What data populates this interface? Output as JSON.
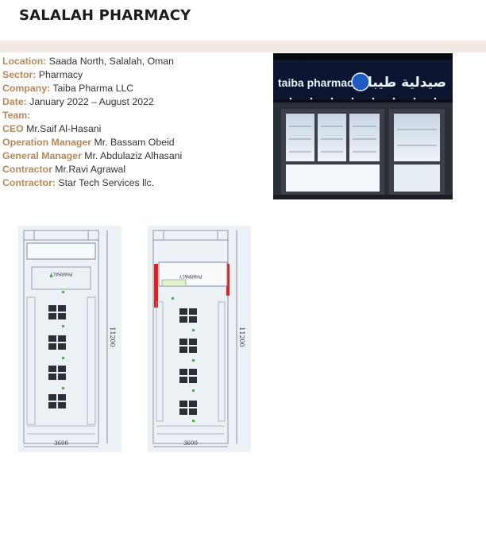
{
  "document": {
    "title": "SALALAH PHARMACY"
  },
  "details": [
    {
      "key": "Location:",
      "value": " Saada North, Salalah, Oman"
    },
    {
      "key": "Sector:",
      "value": " Pharmacy"
    },
    {
      "key": "Company:",
      "value": " Taiba Pharma LLC"
    },
    {
      "key": "Date:",
      "value": " January 2022 – August 2022"
    },
    {
      "key": "Team:",
      "value": ""
    },
    {
      "key": " CEO",
      "value": " Mr.Saif Al-Hasani"
    },
    {
      "key": "Operation Manager",
      "value": " Mr. Bassam Obeid"
    },
    {
      "key": "General Manager",
      "value": " Mr. Abdulaziz Alhasani"
    },
    {
      "key": "Contractor",
      "value": " Mr.Ravi Agrawal"
    },
    {
      "key": "Contractor:",
      "value": " Star Tech Services llc."
    }
  ],
  "storefront_photo": {
    "sign_latin": "taiba pharmacy",
    "sign_arabic": "صيدلية طيبا"
  },
  "floor_plans": [
    {
      "dim_length": "11200",
      "dim_width": "3600",
      "label": "PHARMACY"
    },
    {
      "dim_length": "11200",
      "dim_width": "3600",
      "label": "PHARMACY"
    }
  ],
  "colors": {
    "label_accent": "#b8875b",
    "band": "#f2e9e4",
    "sign_glow": "#e8f4ff",
    "plan_bg": "#ecf1f6"
  }
}
